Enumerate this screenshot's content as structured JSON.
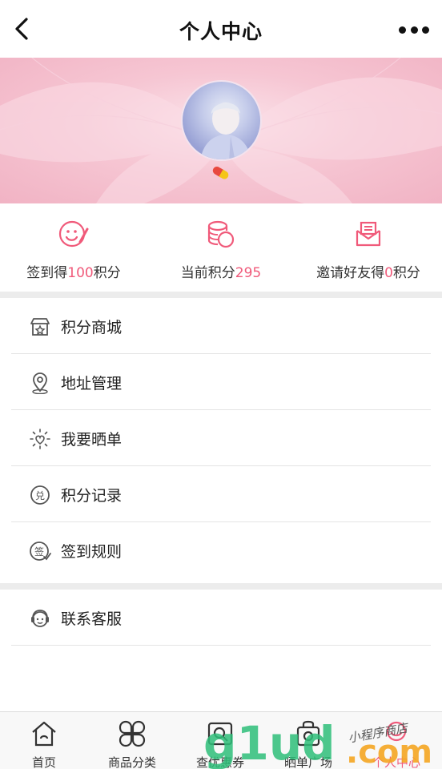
{
  "header": {
    "title": "个人中心"
  },
  "stats": [
    {
      "prefix": "签到得",
      "value": "100",
      "suffix": "积分",
      "icon": "smiley-pen-icon"
    },
    {
      "prefix": "当前积分",
      "value": "295",
      "suffix": "",
      "icon": "coins-icon"
    },
    {
      "prefix": "邀请好友得",
      "value": "0",
      "suffix": "积分",
      "icon": "envelope-icon"
    }
  ],
  "menu": [
    {
      "label": "积分商城",
      "icon": "store-icon"
    },
    {
      "label": "地址管理",
      "icon": "location-pin-icon"
    },
    {
      "label": "我要晒单",
      "icon": "sun-heart-icon"
    },
    {
      "label": "积分记录",
      "icon": "redeem-icon"
    },
    {
      "label": "签到规则",
      "icon": "sign-rule-icon"
    }
  ],
  "service": {
    "label": "联系客服",
    "icon": "customer-service-icon"
  },
  "tabs": [
    {
      "label": "首页",
      "icon": "home-icon"
    },
    {
      "label": "商品分类",
      "icon": "clover-icon"
    },
    {
      "label": "查优惠券",
      "icon": "coupon-search-icon"
    },
    {
      "label": "晒单广场",
      "icon": "camera-bag-icon"
    },
    {
      "label": "个人中心",
      "icon": "profile-icon"
    }
  ],
  "watermark": {
    "text": "g1ud.com",
    "caption": "小程序商店"
  },
  "colors": {
    "accent": "#f05a7a",
    "banner": "#f6c6d3"
  }
}
